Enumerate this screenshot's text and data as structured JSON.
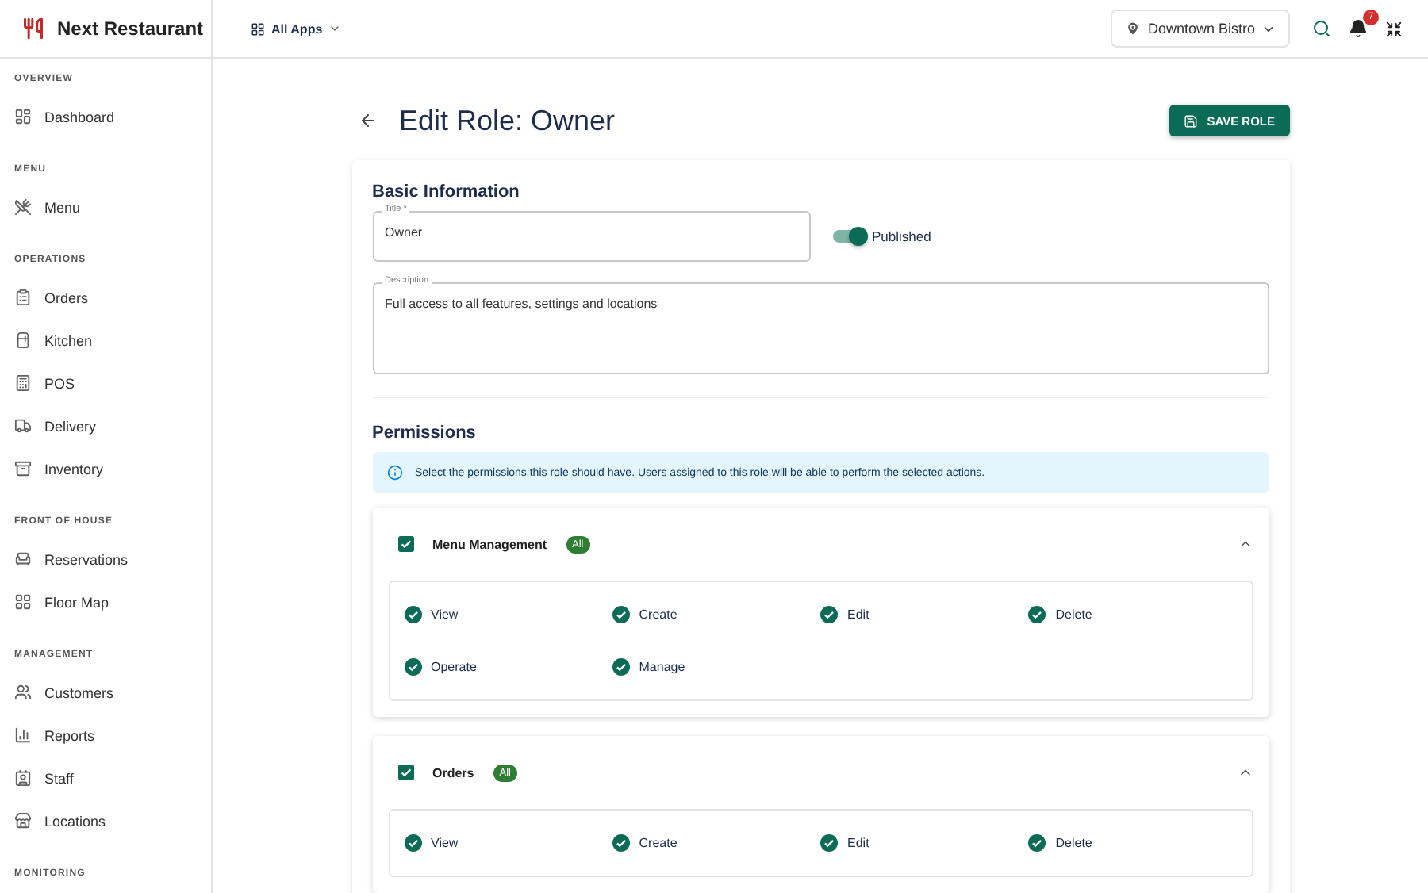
{
  "app": {
    "name": "Next Restaurant"
  },
  "header": {
    "apps_menu": "All Apps",
    "location": "Downtown Bistro",
    "notifications": "7"
  },
  "sidebar": {
    "sections": [
      {
        "heading": "OVERVIEW",
        "items": [
          "Dashboard"
        ]
      },
      {
        "heading": "MENU",
        "items": [
          "Menu"
        ]
      },
      {
        "heading": "OPERATIONS",
        "items": [
          "Orders",
          "Kitchen",
          "POS",
          "Delivery",
          "Inventory"
        ]
      },
      {
        "heading": "FRONT OF HOUSE",
        "items": [
          "Reservations",
          "Floor Map"
        ]
      },
      {
        "heading": "MANAGEMENT",
        "items": [
          "Customers",
          "Reports",
          "Staff",
          "Locations"
        ]
      },
      {
        "heading": "MONITORING"
      }
    ]
  },
  "page": {
    "title": "Edit Role: Owner",
    "save_button": "SAVE ROLE"
  },
  "basic_info": {
    "heading": "Basic Information",
    "title_field": {
      "label": "Title *",
      "value": "Owner"
    },
    "published": {
      "label": "Published",
      "on": true
    },
    "description": {
      "label": "Description",
      "value": "Full access to all features, settings and locations"
    }
  },
  "permissions": {
    "heading": "Permissions",
    "info": "Select the permissions this role should have. Users assigned to this role will be able to perform the selected actions.",
    "groups": [
      {
        "name": "Menu Management",
        "checked": true,
        "badge": "All",
        "expanded": true,
        "permissions": [
          {
            "label": "View",
            "checked": true
          },
          {
            "label": "Create",
            "checked": true
          },
          {
            "label": "Edit",
            "checked": true
          },
          {
            "label": "Delete",
            "checked": true
          },
          {
            "label": "Operate",
            "checked": true
          },
          {
            "label": "Manage",
            "checked": true
          }
        ]
      },
      {
        "name": "Orders",
        "checked": true,
        "badge": "All",
        "expanded": true,
        "permissions": [
          {
            "label": "View",
            "checked": true
          },
          {
            "label": "Create",
            "checked": true
          },
          {
            "label": "Edit",
            "checked": true
          },
          {
            "label": "Delete",
            "checked": true
          }
        ]
      }
    ]
  }
}
